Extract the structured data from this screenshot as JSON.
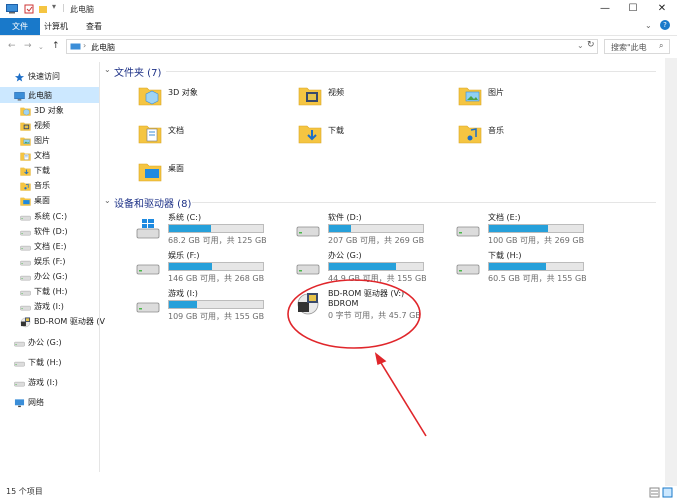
{
  "window": {
    "title": "此电脑",
    "minimize": "—",
    "maximize": "☐",
    "close": "✕"
  },
  "ribbon": {
    "tabs": [
      "文件",
      "计算机",
      "查看"
    ]
  },
  "address": {
    "path": "此电脑",
    "search_placeholder": "搜索\"此电"
  },
  "sidebar": {
    "items": [
      {
        "label": "快速访问",
        "icon": "star-icon"
      },
      {
        "label": "此电脑",
        "icon": "computer-icon",
        "selected": true
      },
      {
        "label": "3D 对象",
        "icon": "3d-objects-icon"
      },
      {
        "label": "视频",
        "icon": "video-icon"
      },
      {
        "label": "图片",
        "icon": "picture-icon"
      },
      {
        "label": "文档",
        "icon": "document-icon"
      },
      {
        "label": "下载",
        "icon": "download-icon"
      },
      {
        "label": "音乐",
        "icon": "music-icon"
      },
      {
        "label": "桌面",
        "icon": "desktop-icon"
      },
      {
        "label": "系统 (C:)",
        "icon": "drive-icon"
      },
      {
        "label": "软件 (D:)",
        "icon": "drive-icon"
      },
      {
        "label": "文档 (E:)",
        "icon": "drive-icon"
      },
      {
        "label": "娱乐 (F:)",
        "icon": "drive-icon"
      },
      {
        "label": "办公 (G:)",
        "icon": "drive-icon"
      },
      {
        "label": "下载 (H:)",
        "icon": "drive-icon"
      },
      {
        "label": "游戏 (I:)",
        "icon": "drive-icon"
      },
      {
        "label": "BD-ROM 驱动器 (V",
        "icon": "bdrom-icon"
      },
      {
        "label": "办公 (G:)",
        "icon": "drive-icon"
      },
      {
        "label": "下载 (H:)",
        "icon": "drive-icon"
      },
      {
        "label": "游戏 (I:)",
        "icon": "drive-icon"
      },
      {
        "label": "网络",
        "icon": "network-icon"
      }
    ]
  },
  "folders_section": {
    "title": "文件夹 (7)",
    "items": [
      {
        "label": "3D 对象",
        "icon": "3d-objects-icon"
      },
      {
        "label": "视频",
        "icon": "video-icon"
      },
      {
        "label": "图片",
        "icon": "picture-icon"
      },
      {
        "label": "文档",
        "icon": "document-icon"
      },
      {
        "label": "下载",
        "icon": "download-icon"
      },
      {
        "label": "音乐",
        "icon": "music-icon"
      },
      {
        "label": "桌面",
        "icon": "desktop-icon"
      }
    ]
  },
  "drives_section": {
    "title": "设备和驱动器 (8)",
    "items": [
      {
        "label": "系统 (C:)",
        "sub": "68.2 GB 可用，共 125 GB",
        "used": 0.45,
        "icon": "windows-drive-icon"
      },
      {
        "label": "软件 (D:)",
        "sub": "207 GB 可用，共 269 GB",
        "used": 0.23,
        "icon": "drive-icon"
      },
      {
        "label": "文档 (E:)",
        "sub": "100 GB 可用，共 269 GB",
        "used": 0.63,
        "icon": "drive-icon"
      },
      {
        "label": "娱乐 (F:)",
        "sub": "146 GB 可用，共 268 GB",
        "used": 0.46,
        "icon": "drive-icon"
      },
      {
        "label": "办公 (G:)",
        "sub": "44.9 GB 可用，共 155 GB",
        "used": 0.71,
        "icon": "drive-icon"
      },
      {
        "label": "下载 (H:)",
        "sub": "60.5 GB 可用，共 155 GB",
        "used": 0.61,
        "icon": "drive-icon"
      },
      {
        "label": "游戏 (I:)",
        "sub": "109 GB 可用，共 155 GB",
        "used": 0.3,
        "icon": "drive-icon"
      },
      {
        "label": "BD-ROM 驱动器 (V:)",
        "label2": "BDROM",
        "sub": "0 字节 可用，共 45.7 GB",
        "icon": "bdrom-icon"
      }
    ]
  },
  "status": {
    "count": "15 个项目"
  },
  "colors": {
    "accent": "#1979ca",
    "bar_fill": "#26a0da",
    "selection": "#cce8ff",
    "annotation": "#e0262b",
    "section_title": "#1e3287"
  }
}
